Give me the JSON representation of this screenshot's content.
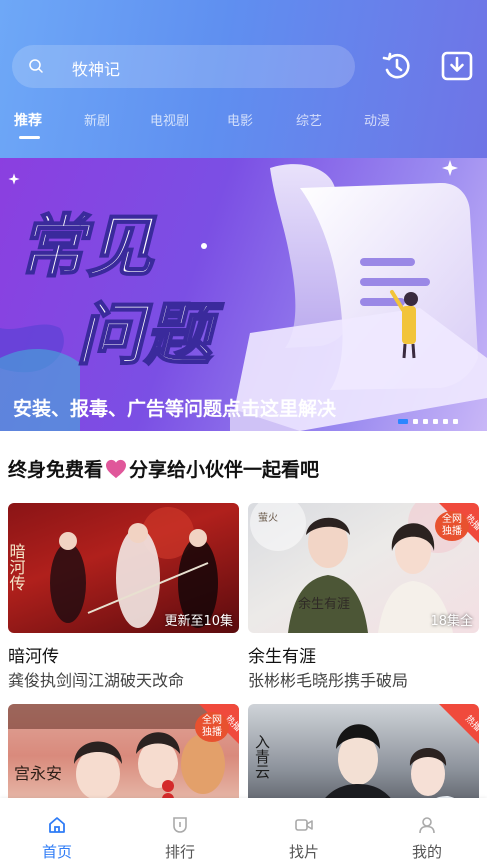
{
  "search": {
    "value": "牧神记"
  },
  "header_icons": [
    "history-icon",
    "download-icon"
  ],
  "tabs": [
    {
      "label": "推荐",
      "active": true
    },
    {
      "label": "新剧",
      "active": false
    },
    {
      "label": "电视剧",
      "active": false
    },
    {
      "label": "电影",
      "active": false
    },
    {
      "label": "综艺",
      "active": false
    },
    {
      "label": "动漫",
      "active": false
    }
  ],
  "banner": {
    "headline_1": "常见",
    "headline_2": "问题",
    "caption": "安装、报毒、广告等问题点击这里解决",
    "slides": 6,
    "active_slide": 1
  },
  "section": {
    "left": "终身免费看",
    "right": "分享给小伙伴一起看吧"
  },
  "cards": [
    {
      "title": "暗河传",
      "subtitle": "龚俊执剑闯江湖破天改命",
      "tag": "更新至10集",
      "badge": "",
      "poster_text": "暗河传"
    },
    {
      "title": "余生有涯",
      "subtitle": "张彬彬毛晓彤携手破局",
      "tag": "18集全",
      "badge": "热播",
      "poster_text": "余生有涯",
      "stamp": "全网\n独播"
    },
    {
      "title": "",
      "subtitle": "",
      "tag": "",
      "badge": "热播",
      "poster_text": "宫永安",
      "stamp": "全网\n独播"
    },
    {
      "title": "",
      "subtitle": "",
      "tag": "",
      "badge": "热播",
      "poster_text": "入青云"
    }
  ],
  "bottom_nav": [
    {
      "label": "首页",
      "icon": "home-icon",
      "active": true
    },
    {
      "label": "排行",
      "icon": "ranking-icon",
      "active": false
    },
    {
      "label": "找片",
      "icon": "video-icon",
      "active": false
    },
    {
      "label": "我的",
      "icon": "user-icon",
      "active": false
    }
  ],
  "colors": {
    "accent": "#2f7cf6",
    "header_start": "#6ea8f7",
    "header_end": "#6f74e6",
    "heart": "#e0579a"
  }
}
